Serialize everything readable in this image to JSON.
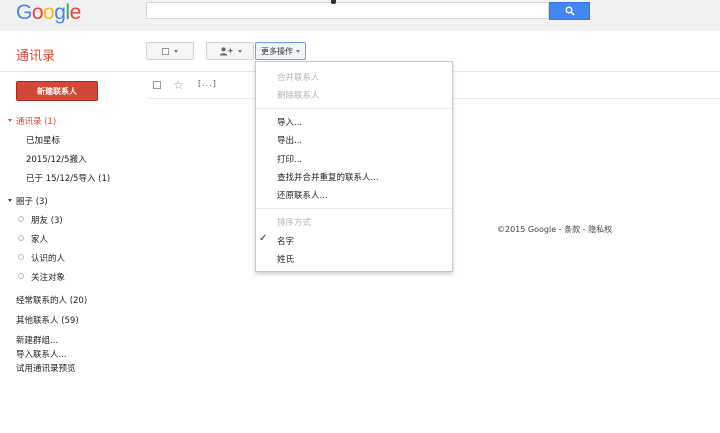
{
  "header": {
    "logo": [
      "G",
      "o",
      "o",
      "g",
      "l",
      "e"
    ],
    "logo_colors": [
      "#4285f4",
      "#ea4335",
      "#fbbc05",
      "#4285f4",
      "#34a853",
      "#ea4335"
    ],
    "search": {
      "value": "",
      "placeholder": ""
    }
  },
  "app": {
    "title": "通讯录"
  },
  "toolbar": {
    "more_label": "更多操作"
  },
  "sidebar": {
    "new_contact": "新建联系人",
    "contacts_label": "通讯录 (1)",
    "contact_sub": [
      "已加星标",
      "2015/12/5搬入",
      "已于 15/12/5导入 (1)"
    ],
    "circles_label": "圈子 (3)",
    "circles": [
      "朋友 (3)",
      "家人",
      "认识的人",
      "关注对象"
    ],
    "frequent": "经常联系的人 (20)",
    "other": "其他联系人 (59)",
    "new_group": "新建群组...",
    "import": "导入联系人...",
    "try_preview": "试用通讯录预览"
  },
  "list": {
    "loading": "[...]"
  },
  "menu": {
    "merge": "合并联系人",
    "delete": "删除联系人",
    "import": "导入...",
    "export": "导出...",
    "print": "打印...",
    "find_merge": "查找并合并重复的联系人...",
    "restore": "还原联系人...",
    "sort_header": "排序方式",
    "sort_first": "名字",
    "sort_last": "姓氏"
  },
  "footer": {
    "copyright": "©2015 Google - ",
    "terms": "条款",
    "sep": " - ",
    "privacy": "隐私权"
  }
}
